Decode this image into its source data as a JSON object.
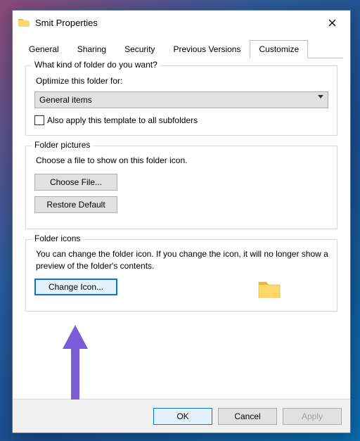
{
  "window": {
    "title": "Smit Properties"
  },
  "tabs": {
    "items": [
      {
        "label": "General"
      },
      {
        "label": "Sharing"
      },
      {
        "label": "Security"
      },
      {
        "label": "Previous Versions"
      },
      {
        "label": "Customize"
      }
    ],
    "active_index": 4
  },
  "group_kind": {
    "title": "What kind of folder do you want?",
    "optimize_label": "Optimize this folder for:",
    "combo_value": "General items",
    "checkbox_label": "Also apply this template to all subfolders"
  },
  "group_pictures": {
    "title": "Folder pictures",
    "desc": "Choose a file to show on this folder icon.",
    "choose_btn": "Choose File...",
    "restore_btn": "Restore Default"
  },
  "group_icons": {
    "title": "Folder icons",
    "desc": "You can change the folder icon. If you change the icon, it will no longer show a preview of the folder's contents.",
    "change_btn": "Change Icon..."
  },
  "footer": {
    "ok": "OK",
    "cancel": "Cancel",
    "apply": "Apply"
  }
}
